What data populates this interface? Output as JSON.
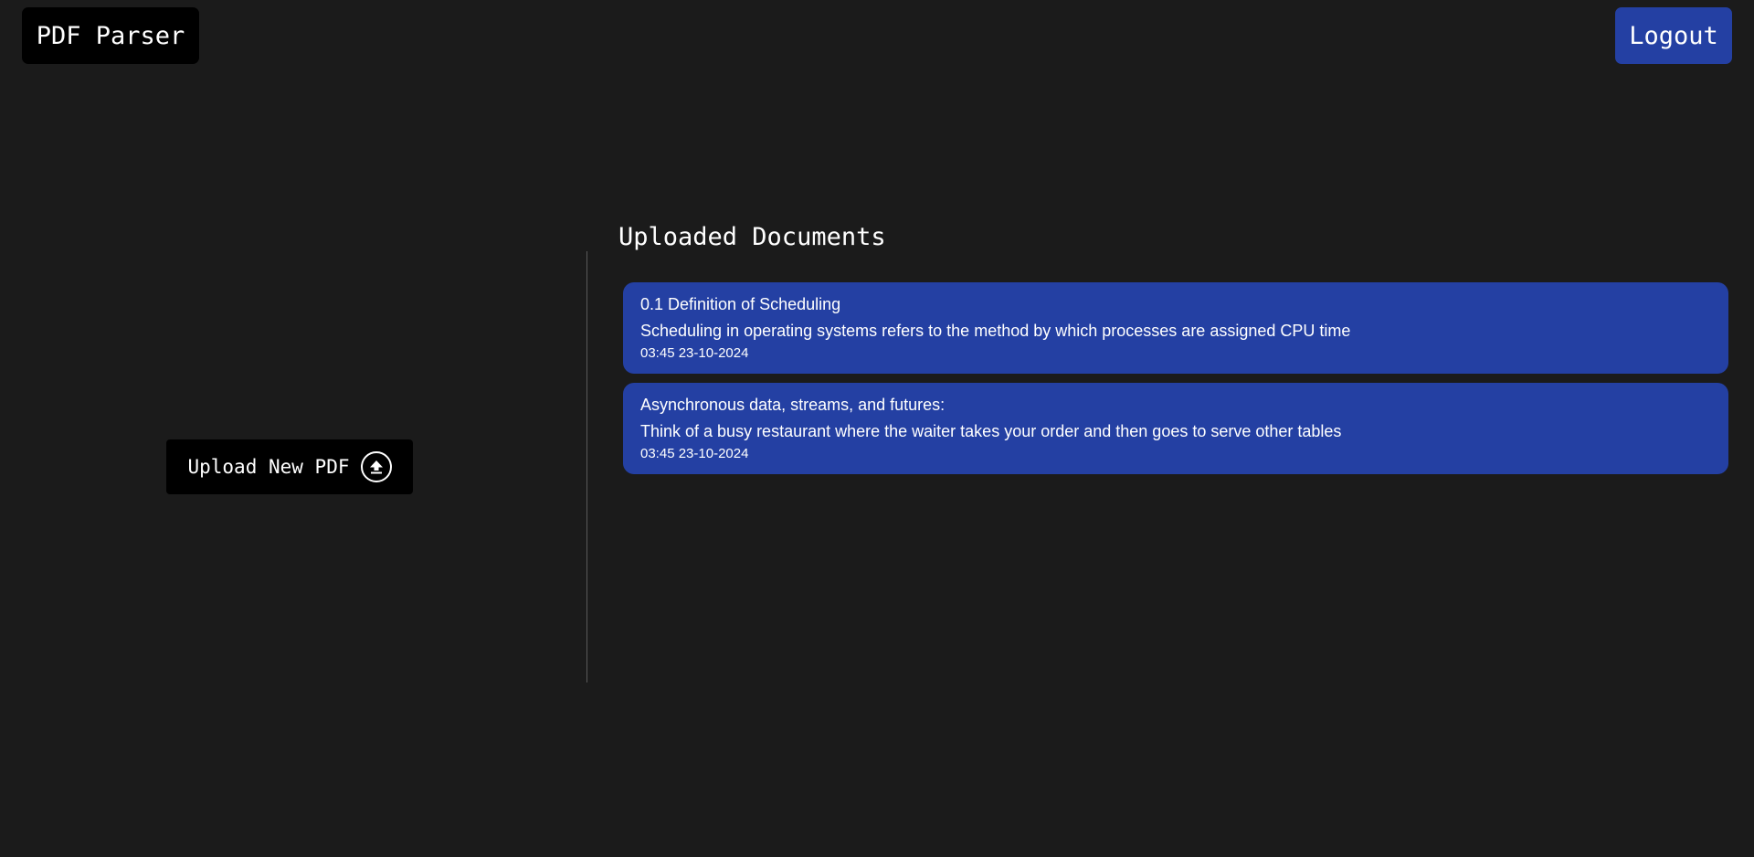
{
  "header": {
    "brand": "PDF Parser",
    "logout_label": "Logout"
  },
  "upload": {
    "label": "Upload New PDF",
    "icon": "upload-icon"
  },
  "documents": {
    "heading": "Uploaded Documents",
    "items": [
      {
        "title": "0.1 Definition of Scheduling",
        "description": "Scheduling in operating systems refers to the method by which processes are assigned CPU time",
        "timestamp": "03:45 23-10-2024"
      },
      {
        "title": "Asynchronous data, streams, and futures:",
        "description": "Think of a busy restaurant where the waiter takes your order and then goes to serve other tables",
        "timestamp": "03:45 23-10-2024"
      }
    ]
  },
  "colors": {
    "background": "#1b1b1b",
    "accent": "#2440a3",
    "panel": "#000000"
  }
}
